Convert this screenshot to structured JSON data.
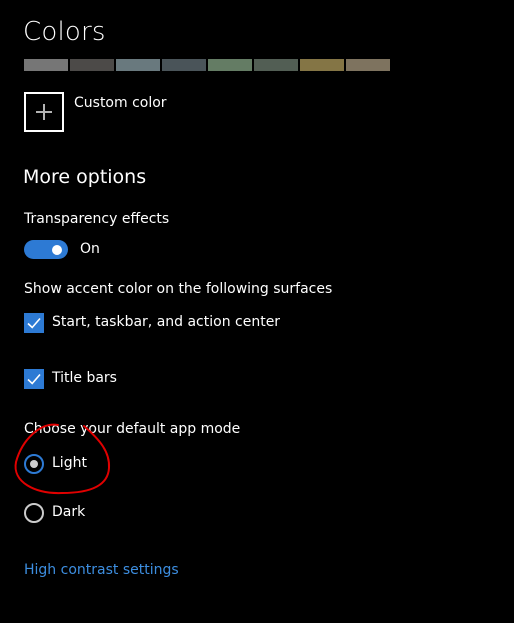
{
  "page": {
    "title": "Colors"
  },
  "swatches": [
    {
      "name": "gray",
      "color": "#767676"
    },
    {
      "name": "dark-gray",
      "color": "#4c4a48"
    },
    {
      "name": "slate-blue-gray",
      "color": "#69797e"
    },
    {
      "name": "storm-gray",
      "color": "#4a5459"
    },
    {
      "name": "sage-green",
      "color": "#647c64"
    },
    {
      "name": "moss-gray",
      "color": "#525e54"
    },
    {
      "name": "olive",
      "color": "#847545"
    },
    {
      "name": "taupe",
      "color": "#7e735f"
    }
  ],
  "custom_color": {
    "label": "Custom color",
    "icon": "plus-icon"
  },
  "more_options": {
    "heading": "More options",
    "transparency": {
      "label": "Transparency effects",
      "state_label": "On",
      "enabled": true
    },
    "accent_surfaces": {
      "label": "Show accent color on the following surfaces",
      "options": [
        {
          "label": "Start, taskbar, and action center",
          "checked": true
        },
        {
          "label": "Title bars",
          "checked": true
        }
      ]
    },
    "app_mode": {
      "label": "Choose your default app mode",
      "options": [
        {
          "label": "Light",
          "selected": true
        },
        {
          "label": "Dark",
          "selected": false
        }
      ]
    }
  },
  "links": {
    "high_contrast": "High contrast settings"
  },
  "colors": {
    "accent": "#2d7ad4",
    "link": "#3d8ee0",
    "background": "#000000",
    "annotation": "#e00000"
  }
}
